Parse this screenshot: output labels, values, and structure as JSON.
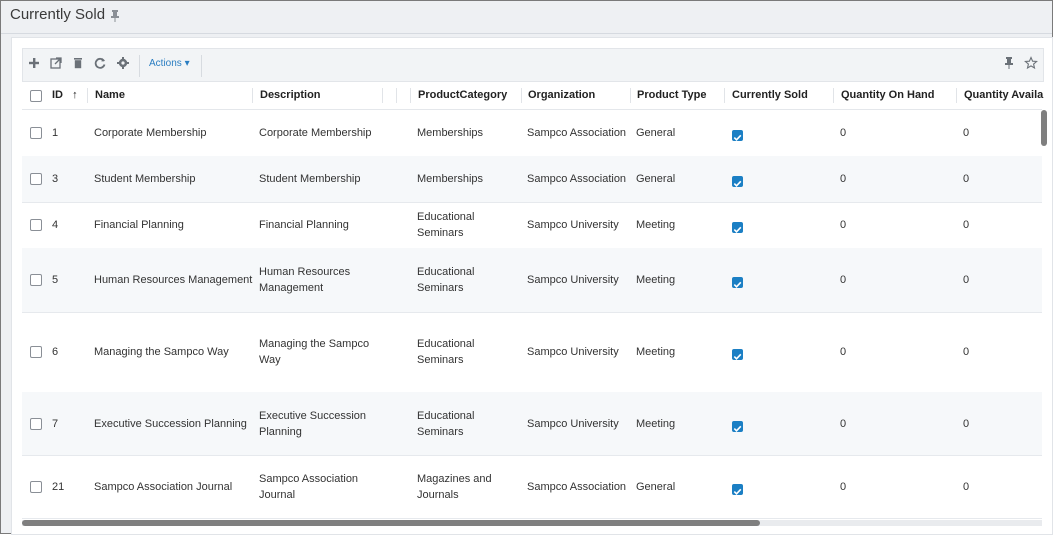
{
  "page": {
    "title": "Currently Sold"
  },
  "toolbar": {
    "actions_label": "Actions",
    "icons": [
      "add-icon",
      "open-external-icon",
      "delete-icon",
      "refresh-icon",
      "settings-icon",
      "pin-icon",
      "star-icon"
    ]
  },
  "grid": {
    "columns": {
      "id": "ID",
      "name": "Name",
      "description": "Description",
      "product_category": "ProductCategory",
      "organization": "Organization",
      "product_type": "Product Type",
      "currently_sold": "Currently Sold",
      "quantity_on_hand": "Quantity On Hand",
      "quantity_available": "Quantity Availab"
    },
    "sort_indicator": "↑",
    "rows": [
      {
        "id": "1",
        "name": "Corporate Membership",
        "description": [
          "Corporate Membership"
        ],
        "category": [
          "Memberships"
        ],
        "organization": "Sampco Association",
        "type": "General",
        "currently_sold": true,
        "on_hand": "0",
        "available": "0"
      },
      {
        "id": "3",
        "name": "Student Membership",
        "description": [
          "Student Membership"
        ],
        "category": [
          "Memberships"
        ],
        "organization": "Sampco Association",
        "type": "General",
        "currently_sold": true,
        "on_hand": "0",
        "available": "0"
      },
      {
        "id": "4",
        "name": "Financial Planning",
        "description": [
          "Financial Planning"
        ],
        "category": [
          "Educational",
          "Seminars"
        ],
        "organization": "Sampco University",
        "type": "Meeting",
        "currently_sold": true,
        "on_hand": "0",
        "available": "0"
      },
      {
        "id": "5",
        "name": "Human Resources Management",
        "description": [
          "Human Resources",
          "Management"
        ],
        "category": [
          "Educational",
          "Seminars"
        ],
        "organization": "Sampco University",
        "type": "Meeting",
        "currently_sold": true,
        "on_hand": "0",
        "available": "0"
      },
      {
        "id": "6",
        "name": "Managing the Sampco Way",
        "description": [
          "Managing the Sampco",
          "Way"
        ],
        "category": [
          "Educational",
          "Seminars"
        ],
        "organization": "Sampco University",
        "type": "Meeting",
        "currently_sold": true,
        "on_hand": "0",
        "available": "0"
      },
      {
        "id": "7",
        "name": "Executive Succession Planning",
        "description": [
          "Executive Succession",
          "Planning"
        ],
        "category": [
          "Educational",
          "Seminars"
        ],
        "organization": "Sampco University",
        "type": "Meeting",
        "currently_sold": true,
        "on_hand": "0",
        "available": "0"
      },
      {
        "id": "21",
        "name": "Sampco Association Journal",
        "description": [
          "Sampco Association",
          "Journal"
        ],
        "category": [
          "Magazines and",
          "Journals"
        ],
        "organization": "Sampco Association",
        "type": "General",
        "currently_sold": true,
        "on_hand": "0",
        "available": "0"
      }
    ]
  },
  "colors": {
    "accent": "#1b7fc4",
    "link": "#2a7dc1",
    "background": "#eef0f3"
  }
}
